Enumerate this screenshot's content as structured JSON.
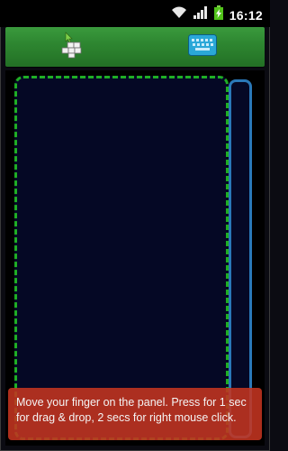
{
  "status_bar": {
    "time": "16:12",
    "icons": [
      "wifi-icon",
      "signal-icon",
      "battery-charging-icon"
    ]
  },
  "toolbar": {
    "buttons": [
      {
        "name": "mouse-mode",
        "icon": "mouse-keys-icon"
      },
      {
        "name": "keyboard-mode",
        "icon": "keyboard-icon"
      }
    ]
  },
  "panel": {
    "hint": "Move your finger on the panel. Press for 1 sec for drag & drop, 2 secs for right mouse click."
  },
  "colors": {
    "toolbar_green": "#2e8731",
    "panel_border_green": "#1fae25",
    "panel_fill": "#050825",
    "scroll_border_blue": "#2a78b8",
    "toast_red": "#c43420"
  }
}
